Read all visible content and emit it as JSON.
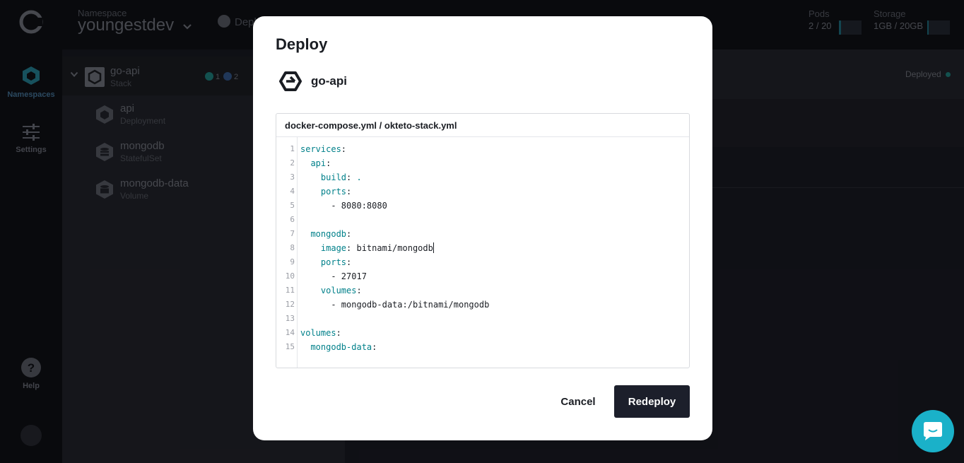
{
  "rail": {
    "namespaces_label": "Namespaces",
    "settings_label": "Settings",
    "help_label": "Help"
  },
  "topbar": {
    "namespace_label": "Namespace",
    "namespace_name": "youngestdev",
    "deploy_label": "Depl",
    "pods_label": "Pods",
    "pods_value": "2 / 20",
    "pods_usage": 0.1,
    "storage_label": "Storage",
    "storage_value": "1GB / 20GB",
    "storage_usage": 0.05
  },
  "stack": {
    "name": "go-api",
    "type": "Stack",
    "ok_count": "1",
    "pending_count": "2",
    "status": "Deployed",
    "items": [
      {
        "name": "api",
        "type": "Deployment",
        "side": "P"
      },
      {
        "name": "mongodb",
        "type": "StatefulSet",
        "side": "P"
      },
      {
        "name": "mongodb-data",
        "type": "Volume",
        "side": ""
      }
    ]
  },
  "modal": {
    "title": "Deploy",
    "stack_name": "go-api",
    "editor_title": "docker-compose.yml / okteto-stack.yml",
    "code_lines": [
      {
        "n": "1",
        "indent": "",
        "key": "services",
        "sep": ":",
        "val": ""
      },
      {
        "n": "2",
        "indent": "  ",
        "key": "api",
        "sep": ":",
        "val": ""
      },
      {
        "n": "3",
        "indent": "    ",
        "key": "build",
        "sep": ": ",
        "val": "."
      },
      {
        "n": "4",
        "indent": "    ",
        "key": "ports",
        "sep": ":",
        "val": ""
      },
      {
        "n": "5",
        "indent": "      ",
        "key": "",
        "sep": "",
        "val": "- 8080:8080"
      },
      {
        "n": "6",
        "indent": "",
        "key": "",
        "sep": "",
        "val": ""
      },
      {
        "n": "7",
        "indent": "  ",
        "key": "mongodb",
        "sep": ":",
        "val": ""
      },
      {
        "n": "8",
        "indent": "    ",
        "key": "image",
        "sep": ": ",
        "val": "bitnami/mongodb"
      },
      {
        "n": "9",
        "indent": "    ",
        "key": "ports",
        "sep": ":",
        "val": ""
      },
      {
        "n": "10",
        "indent": "      ",
        "key": "",
        "sep": "",
        "val": "- 27017"
      },
      {
        "n": "11",
        "indent": "    ",
        "key": "volumes",
        "sep": ":",
        "val": ""
      },
      {
        "n": "12",
        "indent": "      ",
        "key": "",
        "sep": "",
        "val": "- mongodb-data:/bitnami/mongodb"
      },
      {
        "n": "13",
        "indent": "",
        "key": "",
        "sep": "",
        "val": ""
      },
      {
        "n": "14",
        "indent": "",
        "key": "volumes",
        "sep": ":",
        "val": ""
      },
      {
        "n": "15",
        "indent": "  ",
        "key": "mongodb-data",
        "sep": ":",
        "val": ""
      }
    ],
    "cancel_label": "Cancel",
    "redeploy_label": "Redeploy"
  },
  "colors": {
    "accent": "#1ab1c9",
    "yaml_key": "#00808a",
    "primary_button": "#1c1f2b"
  }
}
